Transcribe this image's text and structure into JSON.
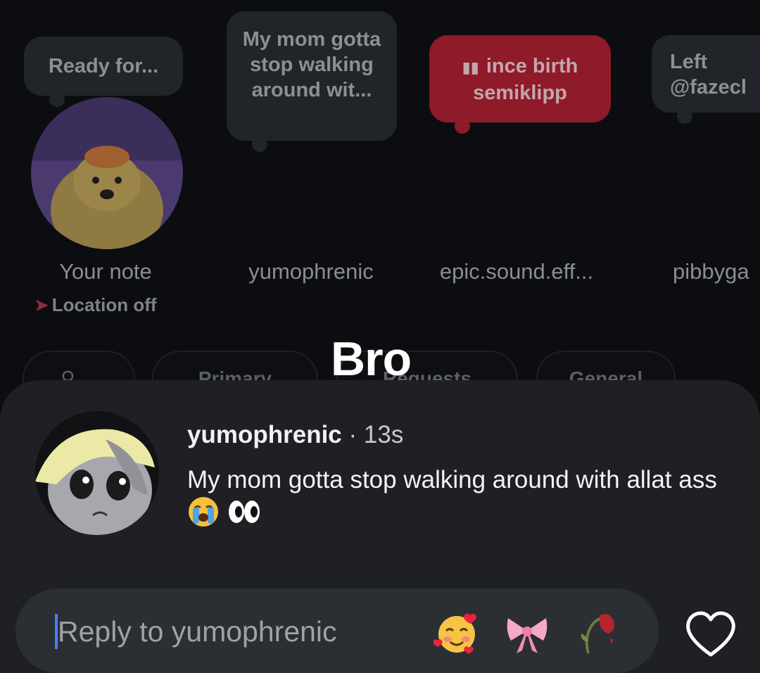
{
  "notes": [
    {
      "bubble": "Ready for...",
      "name": "Your note"
    },
    {
      "bubble": "My mom gotta stop walking around wit...",
      "name": "yumophrenic"
    },
    {
      "bubble": "ince birth",
      "bubble_sub": "semiklipp",
      "name": "epic.sound.eff..."
    },
    {
      "bubble": "Left @fazecl",
      "name": "pibbyga"
    }
  ],
  "location_label": "Location off",
  "filter_pills": [
    "Primary",
    "Requests",
    "General"
  ],
  "overlay_caption": "Bro",
  "message": {
    "username": "yumophrenic",
    "separator": "·",
    "time": "13s",
    "text": "My mom gotta stop walking around with allat ass",
    "emojis": [
      "loudly-crying-face",
      "eyes"
    ]
  },
  "reply": {
    "placeholder": "Reply to yumophrenic",
    "quick_reactions": [
      "smiling-face-with-hearts",
      "ribbon",
      "wilted-flower"
    ]
  },
  "icons": [
    "heart-outline-icon",
    "location-pin-icon",
    "filter-icon"
  ],
  "colors": {
    "background": "#0b0d10",
    "sheet": "#1e2024",
    "reply_bar": "#2b2e33",
    "caret": "#4c7dff",
    "note_red": "#8f1a2a"
  }
}
